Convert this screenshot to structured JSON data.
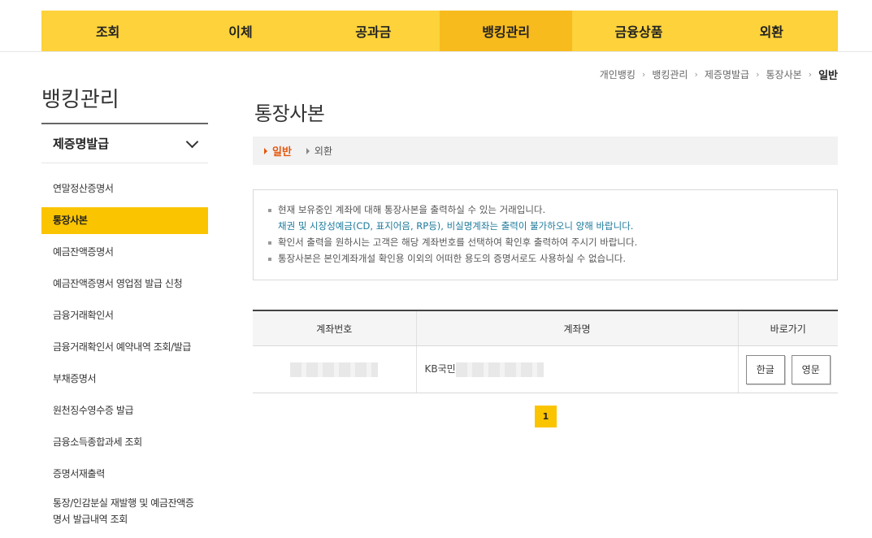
{
  "gnb": {
    "items": [
      {
        "label": "조회"
      },
      {
        "label": "이체"
      },
      {
        "label": "공과금"
      },
      {
        "label": "뱅킹관리"
      },
      {
        "label": "금융상품"
      },
      {
        "label": "외환"
      }
    ],
    "active_index": 3
  },
  "breadcrumb": {
    "items": [
      "개인뱅킹",
      "뱅킹관리",
      "제증명발급",
      "통장사본"
    ],
    "current": "일반"
  },
  "lnb": {
    "title": "뱅킹관리",
    "section": "제증명발급",
    "items": [
      "연말정산증명서",
      "통장사본",
      "예금잔액증명서",
      "예금잔액증명서 영업점 발급 신청",
      "금융거래확인서",
      "금융거래확인서 예약내역 조회/발급",
      "부채증명서",
      "원천징수영수증 발급",
      "금융소득종합과세 조회",
      "증명서재출력",
      "통장/인감분실 재발행 및 예금잔액증명서 발급내역 조회"
    ],
    "active_index": 1
  },
  "main": {
    "title": "통장사본",
    "tabs": [
      {
        "label": "일반"
      },
      {
        "label": "외환"
      }
    ],
    "notices": [
      "현재 보유중인 계좌에 대해 통장사본을 출력하실 수 있는 거래입니다.",
      "채권 및 시장성예금(CD, 표지어음, RP등), 비실명계좌는 출력이 불가하오니 양해 바랍니다.",
      "확인서 출력을 원하시는 고객은 해당 계좌번호를 선택하여 확인후 출력하여 주시기 바랍니다.",
      "통장사본은 본인계좌개설 확인용 이외의 어떠한 용도의 증명서로도 사용하실 수 없습니다."
    ],
    "table": {
      "headers": [
        "계좌번호",
        "계좌명",
        "바로가기"
      ],
      "rows": [
        {
          "account_number": "",
          "account_name_prefix": "KB국민",
          "buttons": [
            "한글",
            "영문"
          ]
        }
      ]
    },
    "pagination": {
      "current": "1"
    }
  },
  "colors": {
    "brand_yellow": "#fdd23b",
    "active_yellow": "#fbc400",
    "accent_orange": "#e4570d",
    "notice_teal": "#1d7a9b"
  }
}
